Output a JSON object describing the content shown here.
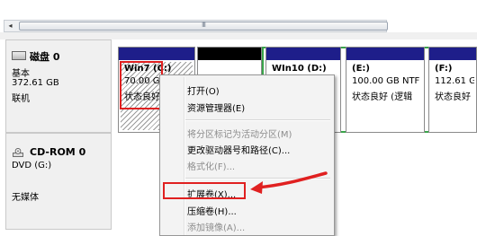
{
  "scrollbar": {
    "grip": "III"
  },
  "disk0": {
    "title": "磁盘 0",
    "type": "基本",
    "size": "372.61 GB",
    "state": "联机"
  },
  "cdrom": {
    "title": "CD-ROM 0",
    "drive": "DVD (G:)",
    "media": "无媒体"
  },
  "partitions": [
    {
      "name": "Win7  (C:)",
      "size": "70.00 G",
      "status": "状态良好"
    },
    {
      "name": "WIn10  (D:)",
      "size": "",
      "status": ""
    },
    {
      "name": "(E:)",
      "size": "100.00 GB NTF",
      "status": "状态良好 (逻辑"
    },
    {
      "name": "(F:)",
      "size": "112.61 GE",
      "status": "状态良好 ("
    }
  ],
  "menu": {
    "items": [
      {
        "label": "打开(O)",
        "enabled": true
      },
      {
        "label": "资源管理器(E)",
        "enabled": true
      },
      {
        "label": "将分区标记为活动分区(M)",
        "enabled": false
      },
      {
        "label": "更改驱动器号和路径(C)...",
        "enabled": true
      },
      {
        "label": "格式化(F)...",
        "enabled": false
      },
      {
        "label": "扩展卷(X)...",
        "enabled": true
      },
      {
        "label": "压缩卷(H)...",
        "enabled": true
      },
      {
        "label": "添加镜像(A)...",
        "enabled": false
      }
    ]
  },
  "colors": {
    "partition_band": "#1e1e8a",
    "highlight": "#e02020",
    "extended_partition": "#3aa44a"
  }
}
